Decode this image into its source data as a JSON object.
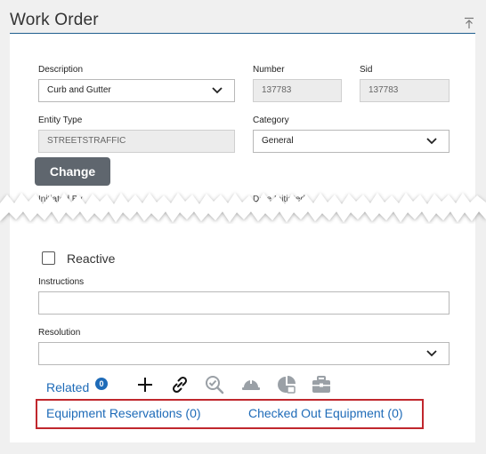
{
  "header": {
    "title": "Work Order"
  },
  "form": {
    "description": {
      "label": "Description",
      "value": "Curb and Gutter"
    },
    "number": {
      "label": "Number",
      "value": "137783"
    },
    "sid": {
      "label": "Sid",
      "value": "137783"
    },
    "entity_type": {
      "label": "Entity Type",
      "value": "STREETSTRAFFIC"
    },
    "category": {
      "label": "Category",
      "value": "General"
    },
    "change_button": "Change",
    "initiated_by_label": "Initiated By",
    "date_initiated_label": "Date Initiated",
    "reactive_label": "Reactive",
    "instructions": {
      "label": "Instructions",
      "value": ""
    },
    "resolution": {
      "label": "Resolution",
      "value": ""
    }
  },
  "related": {
    "label": "Related",
    "count": "0",
    "tools": [
      "add-icon",
      "link-icon",
      "search-check-icon",
      "hard-hat-icon",
      "pie-chart-icon",
      "toolbox-icon"
    ]
  },
  "links": {
    "equipment_reservations": "Equipment Reservations (0)",
    "checked_out_equipment": "Checked Out Equipment (0)"
  },
  "colors": {
    "accent": "#1f5f8f",
    "link": "#1e6bb8",
    "button": "#5f666e",
    "highlight": "#c0272d"
  }
}
